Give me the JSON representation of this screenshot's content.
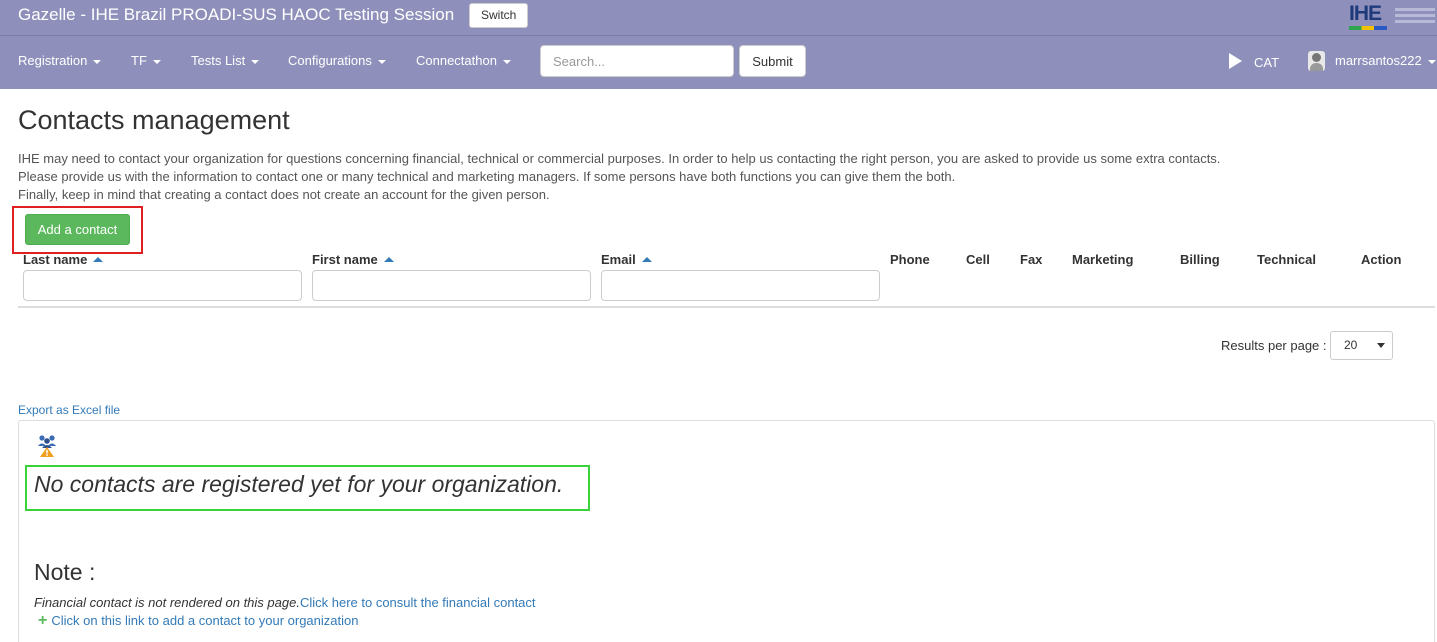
{
  "header": {
    "app_title": "Gazelle - IHE Brazil PROADI-SUS HAOC Testing Session",
    "switch_label": "Switch",
    "logo_text": "IHE"
  },
  "nav": {
    "items": [
      {
        "label": "Registration"
      },
      {
        "label": "TF"
      },
      {
        "label": "Tests List"
      },
      {
        "label": "Configurations"
      },
      {
        "label": "Connectathon"
      }
    ],
    "search_placeholder": "Search...",
    "submit_label": "Submit",
    "cat_label": "CAT",
    "user_name": "marrsantos222"
  },
  "main": {
    "title": "Contacts management",
    "intro": [
      "IHE may need to contact your organization for questions concerning financial, technical or commercial purposes. In order to help us contacting the right person, you are asked to provide us some extra contacts.",
      "Please provide us with the information to contact one or many technical and marketing managers. If some persons have both functions you can give them the both.",
      "Finally, keep in mind that creating a contact does not create an account for the given person."
    ],
    "add_contact_label": "Add a contact",
    "columns": [
      "Last name",
      "First name",
      "Email",
      "Phone",
      "Cell",
      "Fax",
      "Marketing",
      "Billing",
      "Technical",
      "Action"
    ],
    "results_per_page_label": "Results per page :",
    "results_per_page_value": "20",
    "export_label": "Export as Excel file",
    "empty_message": "No contacts are registered yet for your organization.",
    "note_title": "Note :",
    "note_text": "Financial contact is not rendered on this page.",
    "financial_link": "Click here to consult the financial contact",
    "add_link": "Click on this link to add a contact to your organization"
  },
  "colors": {
    "navbar": "#8e90bb",
    "primary_button": "#5cb85c",
    "link": "#337ab7",
    "highlight_red": "#e02020",
    "highlight_green": "#3ad13a"
  },
  "icons": [
    "play-icon",
    "avatar-icon",
    "sort-asc-icon",
    "people-warning-icon",
    "plus-icon",
    "dropdown-caret-icon"
  ]
}
